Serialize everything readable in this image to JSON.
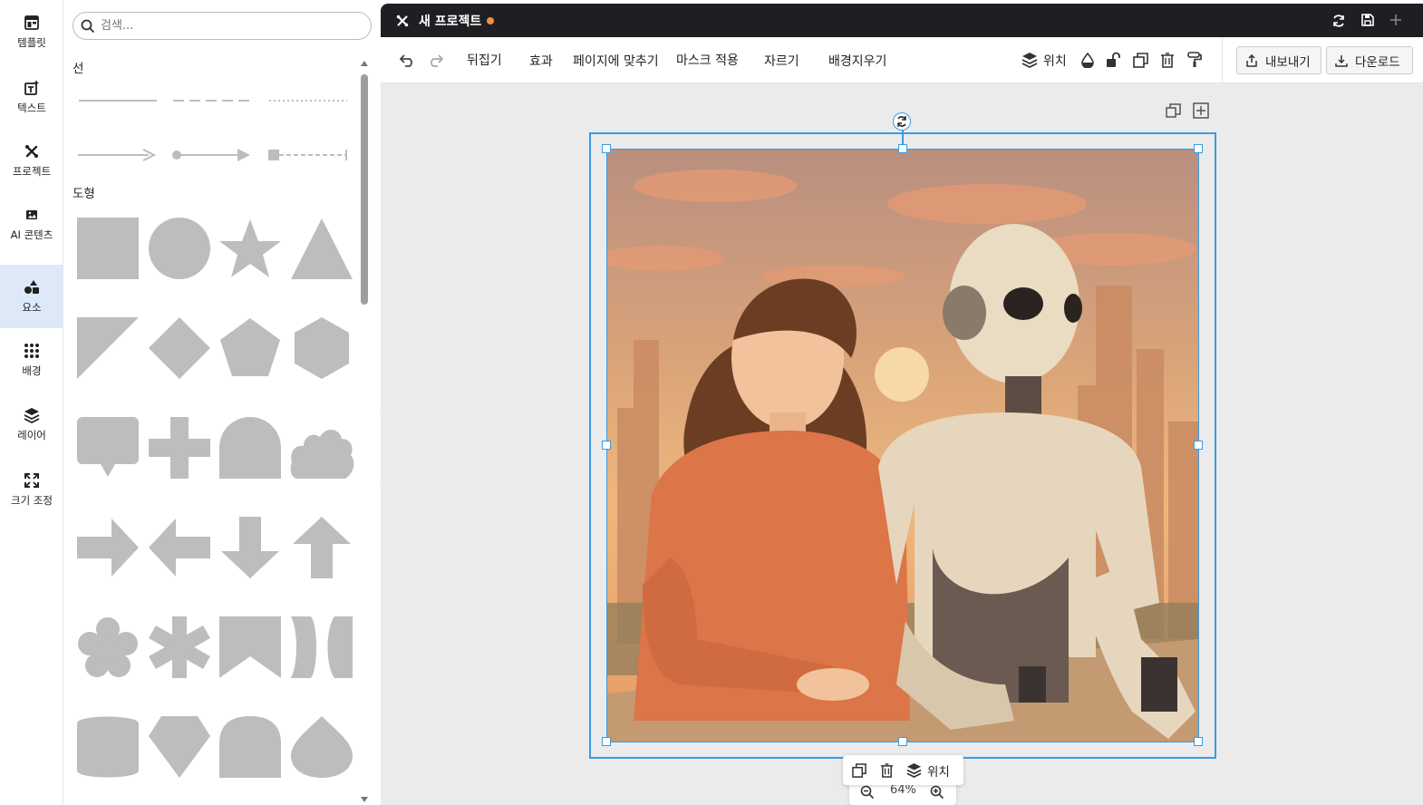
{
  "rail": {
    "items": [
      {
        "label": "템플릿",
        "icon": "template-icon"
      },
      {
        "label": "텍스트",
        "icon": "text-add-icon"
      },
      {
        "label": "프로젝트",
        "icon": "project-icon"
      },
      {
        "label": "AI 콘텐츠",
        "icon": "image-icon"
      },
      {
        "label": "요소",
        "icon": "elements-icon",
        "active": true
      },
      {
        "label": "배경",
        "icon": "grid-dots-icon"
      },
      {
        "label": "레이어",
        "icon": "layers-icon"
      },
      {
        "label": "크기 조정",
        "icon": "resize-icon"
      }
    ]
  },
  "panel": {
    "search_placeholder": "검색...",
    "lines_title": "선",
    "shapes_title": "도형"
  },
  "topbar": {
    "project_title": "새 프로젝트",
    "unsaved_color": "#f0903c"
  },
  "toolbar": {
    "flip": "뒤집기",
    "effects": "효과",
    "fit_page": "페이지에 맞추기",
    "apply_mask": "마스크 적용",
    "crop": "자르기",
    "remove_bg": "배경지우기",
    "position": "위치",
    "export": "내보내기",
    "download": "다운로드"
  },
  "floatbar": {
    "position": "위치"
  },
  "zoom": {
    "level": "64%"
  },
  "colors": {
    "accent": "#3b9ae1",
    "topbar_bg": "#1f1f23",
    "shape_fill": "#bdbdbd"
  }
}
